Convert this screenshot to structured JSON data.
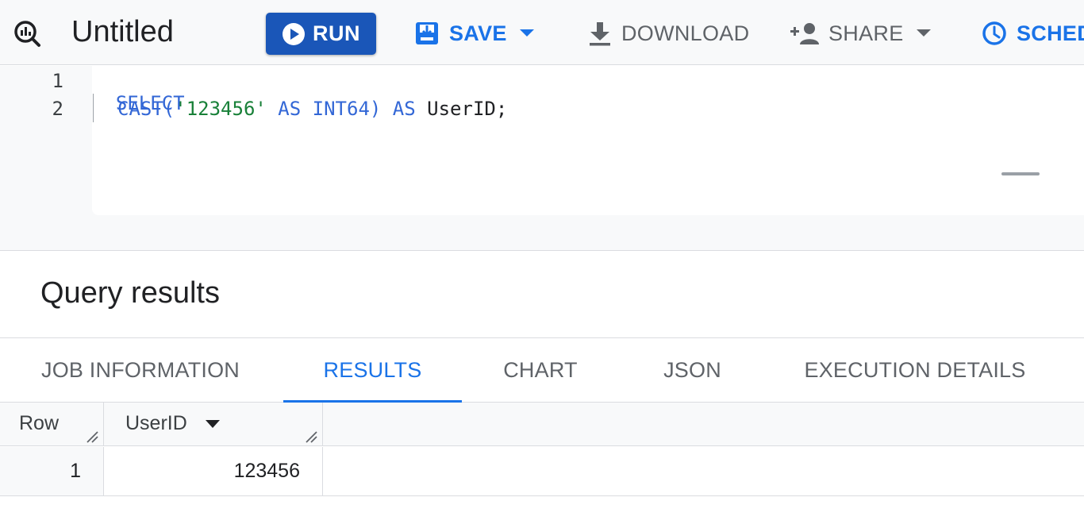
{
  "toolbar": {
    "title": "Untitled",
    "run_label": "RUN",
    "save_label": "SAVE",
    "download_label": "DOWNLOAD",
    "share_label": "SHARE",
    "schedule_label": "SCHED",
    "accent_color": "#1a73e8",
    "run_color": "#1a56b8",
    "icons": [
      "query-icon",
      "play-icon",
      "save-icon",
      "download-icon",
      "share-icon",
      "schedule-icon"
    ]
  },
  "editor": {
    "line_numbers": [
      "1",
      "2"
    ],
    "line1": {
      "kw": "SELECT"
    },
    "line2": {
      "fn": "CAST(",
      "str": "'123456'",
      "as1": " AS INT64) AS ",
      "ident": "UserID;"
    }
  },
  "results": {
    "title": "Query results",
    "tabs": [
      {
        "label": "JOB INFORMATION",
        "active": false
      },
      {
        "label": "RESULTS",
        "active": true
      },
      {
        "label": "CHART",
        "active": false
      },
      {
        "label": "JSON",
        "active": false
      },
      {
        "label": "EXECUTION DETAILS",
        "active": false
      }
    ],
    "columns": [
      "Row",
      "UserID"
    ],
    "rows": [
      {
        "row": "1",
        "UserID": "123456"
      }
    ]
  }
}
